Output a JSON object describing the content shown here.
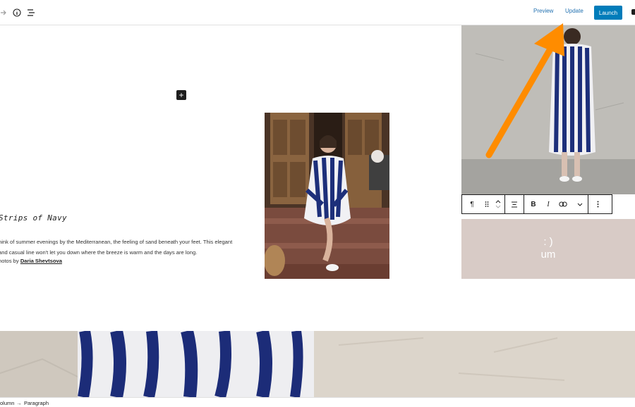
{
  "topbar": {
    "preview_label": "Preview",
    "update_label": "Update",
    "launch_label": "Launch",
    "icons": [
      "redo-icon",
      "info-icon",
      "list-view-icon",
      "settings-icon"
    ]
  },
  "post": {
    "title": "Strips of Navy",
    "body": "hink of summer evenings by the Mediterranean, the feeling of sand beneath your feet. This elegant and casual line won't let you down where the breeze is warm and the days are long.",
    "credit_prefix": "hotos by ",
    "credit_name": "Daria Shevtsova"
  },
  "block_toolbar": {
    "paragraph_glyph": "¶",
    "bold_label": "B",
    "italic_label": "I"
  },
  "pink_block": {
    "line1": ": )",
    "line2": "um"
  },
  "breadcrumb": {
    "items": [
      "olumn",
      "Paragraph"
    ],
    "separator": "→"
  },
  "colors": {
    "accent": "#007cba",
    "link": "#2271b1",
    "annotation_arrow": "#ff8c00",
    "pink_block": "#d8cbc6"
  }
}
